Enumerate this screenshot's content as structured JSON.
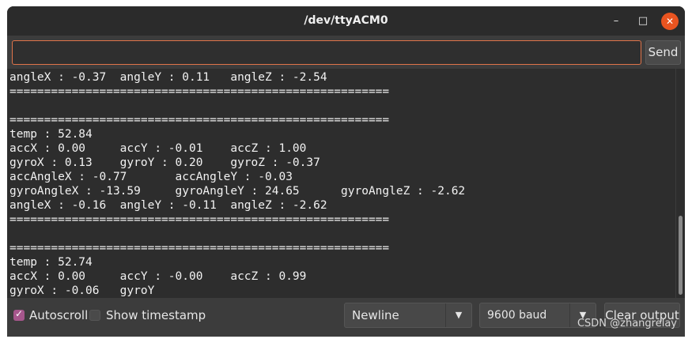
{
  "window": {
    "title": "/dev/ttyACM0",
    "controls": {
      "minimize_glyph": "–",
      "maximize_glyph": "□",
      "close_glyph": "✕"
    }
  },
  "send": {
    "input_value": "",
    "button_label": "Send"
  },
  "output": {
    "lines": [
      "angleX : -0.37  angleY : 0.11   angleZ : -2.54",
      "=======================================================",
      "",
      "=======================================================",
      "temp : 52.84",
      "accX : 0.00     accY : -0.01    accZ : 1.00",
      "gyroX : 0.13    gyroY : 0.20    gyroZ : -0.37",
      "accAngleX : -0.77       accAngleY : -0.03",
      "gyroAngleX : -13.59     gyroAngleY : 24.65      gyroAngleZ : -2.62",
      "angleX : -0.16  angleY : -0.11  angleZ : -2.62",
      "=======================================================",
      "",
      "=======================================================",
      "temp : 52.74",
      "accX : 0.00     accY : -0.00    accZ : 0.99",
      "gyroX : -0.06   gyroY"
    ]
  },
  "footer": {
    "autoscroll": {
      "label": "Autoscroll",
      "checked": true
    },
    "show_timestamp": {
      "label": "Show timestamp",
      "checked": false
    },
    "line_ending": {
      "selected": "Newline"
    },
    "baud_rate": {
      "selected": "9600 baud"
    },
    "clear_button_label": "Clear output",
    "watermark": "CSDN @zhangrelay"
  },
  "colors": {
    "accent": "#e95420",
    "checkbox": "#a6568c",
    "input_border": "#e0744a"
  },
  "icons": {
    "check": "check-icon",
    "dropdown": "chevron-down-icon"
  }
}
